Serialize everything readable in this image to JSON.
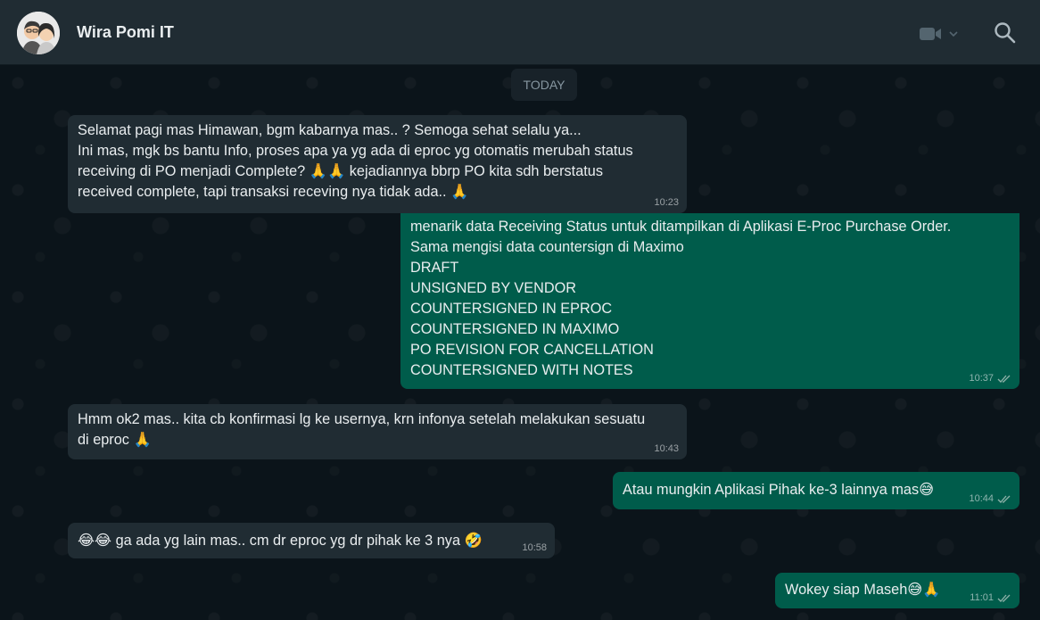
{
  "header": {
    "contact_name": "Wira Pomi IT",
    "avatar_icon": "contact-avatar",
    "video_icon": "video-camera-icon",
    "dropdown_icon": "chevron-down-icon",
    "search_icon": "search-icon"
  },
  "chat": {
    "date_chip": "TODAY",
    "messages": [
      {
        "direction": "incoming",
        "lines": [
          "Selamat pagi mas Himawan, bgm kabarnya mas.. ? Semoga sehat selalu ya...",
          "Ini mas, mgk bs bantu Info, proses apa ya yg ada di eproc yg otomatis merubah status",
          "receiving di PO menjadi Complete? 🙏🙏 kejadiannya bbrp PO kita sdh berstatus",
          "received complete, tapi transaksi receving nya tidak ada.. 🙏"
        ],
        "time": "10:23"
      },
      {
        "direction": "outgoing",
        "lines": [
          "menarik data Receiving Status untuk ditampilkan di Aplikasi E-Proc Purchase Order.",
          "Sama mengisi data countersign di Maximo",
          "DRAFT",
          "UNSIGNED BY VENDOR",
          "COUNTERSIGNED IN EPROC",
          "COUNTERSIGNED IN MAXIMO",
          "PO REVISION FOR CANCELLATION",
          "COUNTERSIGNED WITH NOTES"
        ],
        "time": "10:37",
        "status_icon": "double-check-icon"
      },
      {
        "direction": "incoming",
        "lines": [
          "Hmm ok2 mas.. kita cb konfirmasi lg ke usernya, krn infonya setelah melakukan sesuatu",
          "di eproc 🙏"
        ],
        "time": "10:43"
      },
      {
        "direction": "outgoing",
        "lines": [
          "Atau mungkin Aplikasi Pihak ke-3 lainnya mas😅"
        ],
        "time": "10:44",
        "status_icon": "double-check-icon"
      },
      {
        "direction": "incoming",
        "lines": [
          "😂😂 ga ada yg lain mas.. cm dr eproc yg dr pihak ke 3 nya 🤣"
        ],
        "time": "10:58"
      },
      {
        "direction": "outgoing",
        "lines": [
          "Wokey siap Maseh😅🙏"
        ],
        "time": "11:01",
        "status_icon": "double-check-icon"
      }
    ]
  },
  "colors": {
    "header_bg": "#202c33",
    "chat_bg": "#0b141a",
    "incoming_bubble": "#202c33",
    "outgoing_bubble": "#005c4b",
    "meta_text": "#8696a0"
  }
}
